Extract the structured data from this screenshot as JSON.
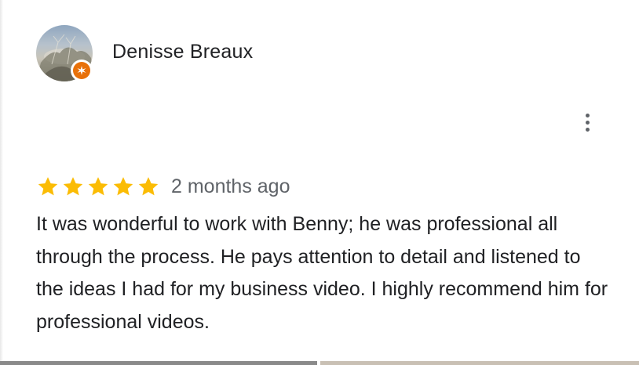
{
  "review": {
    "reviewer_name": "Denisse Breaux",
    "avatar_icon": "profile-photo",
    "badge_icon": "local-guide-star-icon",
    "badge_color": "#e8710a",
    "rating": 5,
    "rating_max": 5,
    "star_color": "#fbbc04",
    "date": "2 months ago",
    "text": "It was wonderful to work with Benny; he was professional all through the process. He pays attention to detail and listened to the ideas I had for my business video. I highly recommend him for professional videos.",
    "more_icon": "more-vert-icon"
  }
}
